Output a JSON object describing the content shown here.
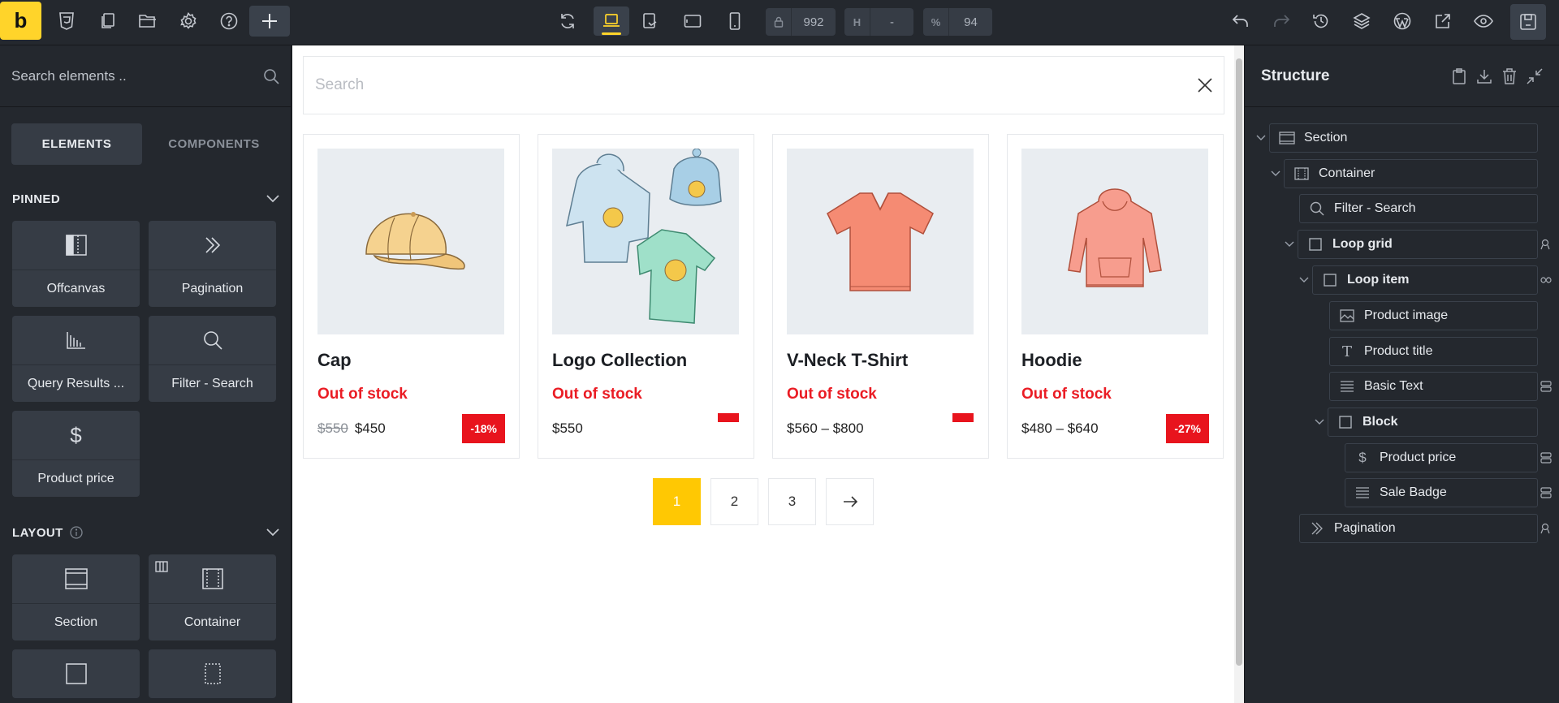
{
  "toolbar": {
    "logo": "b",
    "width_value": "992",
    "height_prefix": "H",
    "height_value": "-",
    "zoom_prefix": "%",
    "zoom_value": "94"
  },
  "left": {
    "search_placeholder": "Search elements ..",
    "tabs": [
      "ELEMENTS",
      "COMPONENTS"
    ],
    "pinned_heading": "PINNED",
    "pinned": [
      {
        "label": "Offcanvas",
        "icon": "offcanvas-icon"
      },
      {
        "label": "Pagination",
        "icon": "chevrons-right-icon"
      },
      {
        "label": "Query Results ...",
        "icon": "query-results-icon"
      },
      {
        "label": "Filter - Search",
        "icon": "search-icon"
      },
      {
        "label": "Product price",
        "icon": "dollar-icon"
      }
    ],
    "layout_heading": "LAYOUT",
    "layout": [
      {
        "label": "Section",
        "icon": "section-icon"
      },
      {
        "label": "Container",
        "icon": "container-icon"
      }
    ]
  },
  "canvas": {
    "search_placeholder": "Search",
    "products": [
      {
        "title": "Cap",
        "stock": "Out of stock",
        "old_price": "$550",
        "price": "$450",
        "badge": "-18%"
      },
      {
        "title": "Logo Collection",
        "stock": "Out of stock",
        "old_price": "",
        "price": "$550",
        "badge": ""
      },
      {
        "title": "V-Neck T-Shirt",
        "stock": "Out of stock",
        "old_price": "",
        "price": "$560 – $800",
        "badge": ""
      },
      {
        "title": "Hoodie",
        "stock": "Out of stock",
        "old_price": "",
        "price": "$480 – $640",
        "badge": "-27%"
      }
    ],
    "pagination": [
      "1",
      "2",
      "3"
    ],
    "accent": "#ffc803",
    "sale_color": "#e8141d"
  },
  "structure": {
    "title": "Structure",
    "nodes": [
      {
        "label": "Section",
        "icon": "section-icon"
      },
      {
        "label": "Container",
        "icon": "container-icon"
      },
      {
        "label": "Filter - Search",
        "icon": "search-icon"
      },
      {
        "label": "Loop grid",
        "icon": "box-icon"
      },
      {
        "label": "Loop item",
        "icon": "box-icon"
      },
      {
        "label": "Product image",
        "icon": "image-icon"
      },
      {
        "label": "Product title",
        "icon": "text-icon"
      },
      {
        "label": "Basic Text",
        "icon": "lines-icon"
      },
      {
        "label": "Block",
        "icon": "box-icon"
      },
      {
        "label": "Product price",
        "icon": "dollar-icon"
      },
      {
        "label": "Sale Badge",
        "icon": "lines-icon"
      },
      {
        "label": "Pagination",
        "icon": "chevrons-right-icon"
      }
    ]
  }
}
